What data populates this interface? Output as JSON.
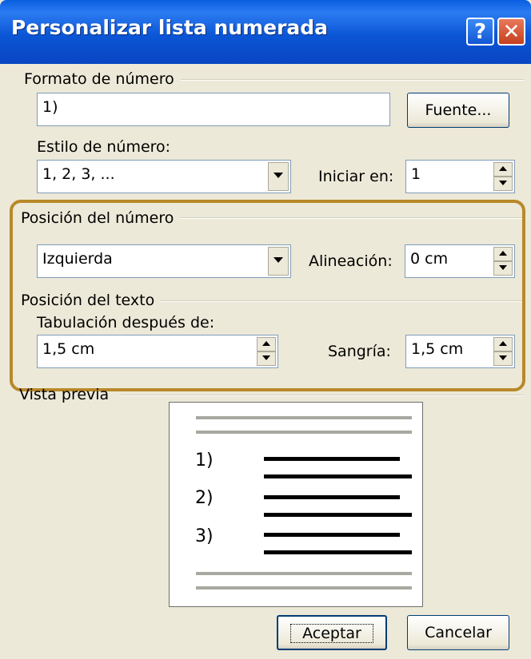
{
  "dialog": {
    "title": "Personalizar lista numerada",
    "help_glyph": "?",
    "close_glyph": "✕"
  },
  "format": {
    "group_label": "Formato de número",
    "value": "1)",
    "font_button": "Fuente..."
  },
  "style": {
    "label": "Estilo de número:",
    "value": "1, 2, 3, ...",
    "start_label": "Iniciar en:",
    "start_value": "1"
  },
  "number_position": {
    "group_label": "Posición del número",
    "value": "Izquierda",
    "align_label": "Alineación:",
    "align_value": "0 cm"
  },
  "text_position": {
    "group_label": "Posición del texto",
    "tab_label": "Tabulación después de:",
    "tab_value": "1,5 cm",
    "indent_label": "Sangría:",
    "indent_value": "1,5 cm"
  },
  "preview": {
    "group_label": "Vista previa",
    "items": [
      "1)",
      "2)",
      "3)"
    ]
  },
  "buttons": {
    "ok": "Aceptar",
    "cancel": "Cancelar"
  },
  "colors": {
    "titlebar": "#0b56d6",
    "face": "#ece9d8",
    "highlight": "#b8892a"
  }
}
